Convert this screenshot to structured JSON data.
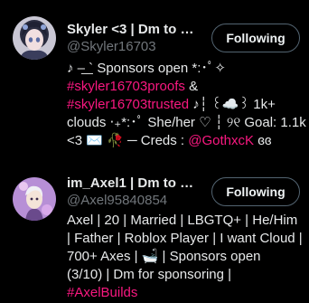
{
  "colors": {
    "background": "#000000",
    "text": "#e7e9ea",
    "muted": "#71767b",
    "hashtag": "#f91880",
    "button_border": "#536471"
  },
  "users": [
    {
      "name": "Skyler <3 | Dm to s...",
      "handle": "@Skyler16703",
      "button": "Following",
      "bio": {
        "line1": "♪ ‒͟ ` Sponsors open *:･ﾟ✧",
        "line2_tag": "#skyler16703proofs",
        "line2_rest": " &",
        "line3_tag": "#skyler16703trusted",
        "line3_rest": " ♪┆ ꒰☁️꒱ 1k+",
        "line4": "clouds ‧₊*:･ﾟ She/her ♡ ┆ ୨୧ Goal: 1.1k",
        "line5_start": "<3 ✉️ 🥀 ─ Creds : ",
        "line5_tag": "@GothxcK",
        "line5_end": " ɞɞ"
      }
    },
    {
      "name": "im_Axel1 | Dm to sp...",
      "handle": "@Axel95840854",
      "button": "Following",
      "bio": {
        "line1": "Axel | 20 | Married | LBGTQ+ | He/Him",
        "line2": "| Father | Roblox Player | I want Cloud |",
        "line3": "700+ Axes | 🛁 | Sponsors open",
        "line4": "(3/10) | Dm for sponsoring |",
        "line5_tag": "#AxelBuilds"
      }
    }
  ]
}
